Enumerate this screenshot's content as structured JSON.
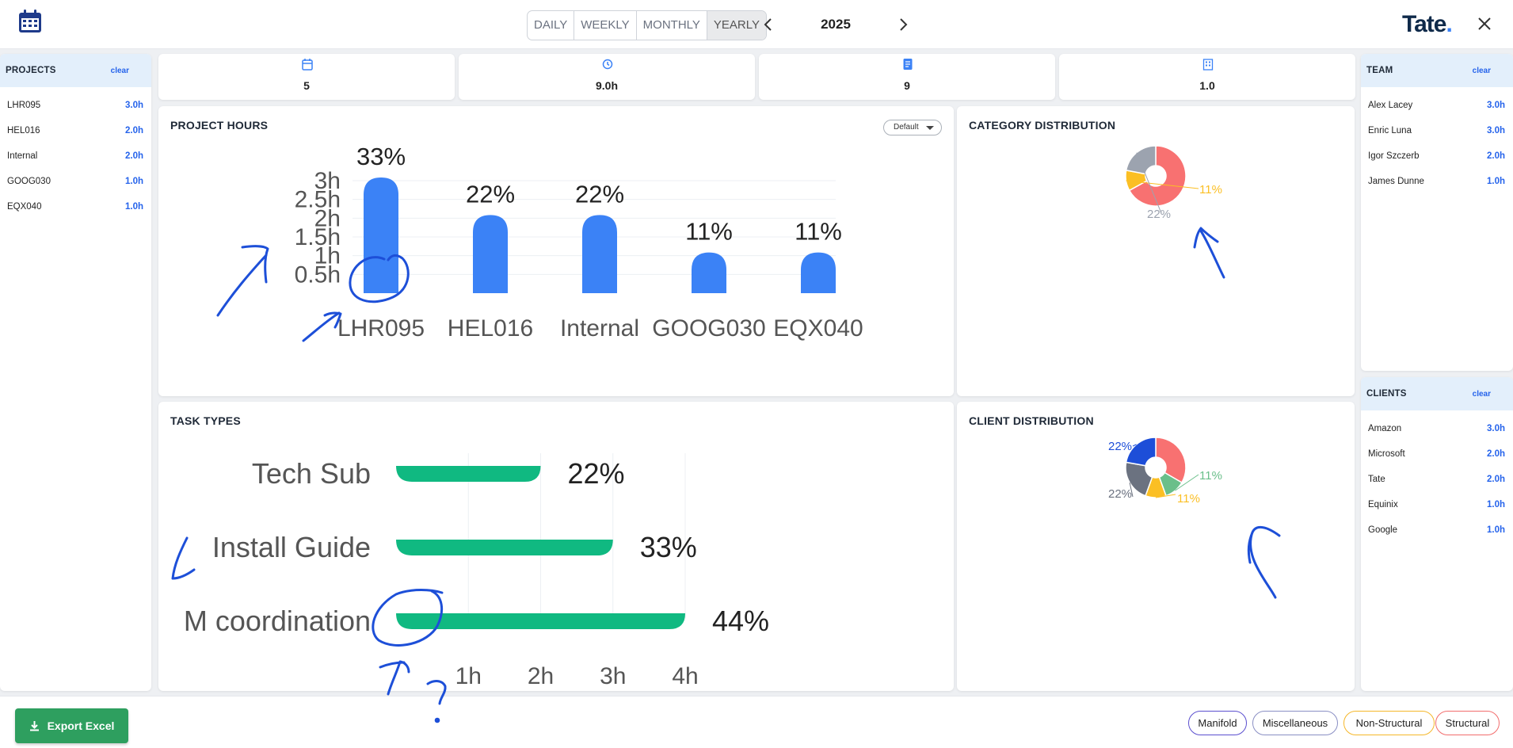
{
  "header": {
    "periods": [
      "DAILY",
      "WEEKLY",
      "MONTHLY",
      "YEARLY"
    ],
    "active_period": "YEARLY",
    "year": "2025",
    "brand": "Tate",
    "brand_dot": "."
  },
  "projects_panel": {
    "title": "PROJECTS",
    "clear_label": "clear",
    "items": [
      {
        "label": "LHR095",
        "hours": "3.0h"
      },
      {
        "label": "HEL016",
        "hours": "2.0h"
      },
      {
        "label": "Internal",
        "hours": "2.0h"
      },
      {
        "label": "GOOG030",
        "hours": "1.0h"
      },
      {
        "label": "EQX040",
        "hours": "1.0h"
      }
    ]
  },
  "stats": [
    {
      "icon": "calendar-icon",
      "value": "5"
    },
    {
      "icon": "clock-icon",
      "value": "9.0h"
    },
    {
      "icon": "document-icon",
      "value": "9"
    },
    {
      "icon": "building-icon",
      "value": "1.0"
    }
  ],
  "project_hours": {
    "title": "PROJECT HOURS",
    "dropdown_value": "Default"
  },
  "category_distribution": {
    "title": "CATEGORY DISTRIBUTION"
  },
  "task_types": {
    "title": "TASK TYPES"
  },
  "client_distribution": {
    "title": "CLIENT DISTRIBUTION"
  },
  "team_panel": {
    "title": "TEAM",
    "clear_label": "clear",
    "items": [
      {
        "label": "Alex Lacey",
        "hours": "3.0h"
      },
      {
        "label": "Enric Luna",
        "hours": "3.0h"
      },
      {
        "label": "Igor Szczerb",
        "hours": "2.0h"
      },
      {
        "label": "James Dunne",
        "hours": "1.0h"
      }
    ]
  },
  "clients_panel": {
    "title": "CLIENTS",
    "clear_label": "clear",
    "items": [
      {
        "label": "Amazon",
        "hours": "3.0h"
      },
      {
        "label": "Microsoft",
        "hours": "2.0h"
      },
      {
        "label": "Tate",
        "hours": "2.0h"
      },
      {
        "label": "Equinix",
        "hours": "1.0h"
      },
      {
        "label": "Google",
        "hours": "1.0h"
      }
    ]
  },
  "footer": {
    "export_label": "Export Excel",
    "legend": [
      {
        "label": "Manifold",
        "color": "#5b4fcf"
      },
      {
        "label": "Miscellaneous",
        "color": "#8a8fc4"
      },
      {
        "label": "Non-Structural",
        "color": "#f5b72a"
      },
      {
        "label": "Structural",
        "color": "#f26d6d"
      }
    ]
  },
  "colors": {
    "accent": "#2563eb",
    "bar_blue": "#3b82f6",
    "bar_green": "#10b981",
    "export_green": "#2e9f5f"
  },
  "chart_data": [
    {
      "type": "bar",
      "title": "PROJECT HOURS",
      "categories": [
        "LHR095",
        "HEL016",
        "Internal",
        "GOOG030",
        "EQX040"
      ],
      "values": [
        3,
        2,
        2,
        1,
        1
      ],
      "data_labels": [
        "33%",
        "22%",
        "22%",
        "11%",
        "11%"
      ],
      "y_ticks": [
        "0.5h",
        "1h",
        "1.5h",
        "2h",
        "2.5h",
        "3h"
      ],
      "ylim": [
        0,
        3
      ]
    },
    {
      "type": "pie",
      "title": "CATEGORY DISTRIBUTION",
      "values": [
        67,
        11,
        22
      ],
      "colors": [
        "#f87171",
        "#fbbf24",
        "#9ca3af"
      ],
      "labels": [
        "",
        "11%",
        "22%"
      ]
    },
    {
      "type": "bar",
      "orientation": "horizontal",
      "title": "TASK TYPES",
      "categories": [
        "Tech Sub",
        "Install Guide",
        "M coordination"
      ],
      "values": [
        2,
        3,
        4
      ],
      "data_labels": [
        "22%",
        "33%",
        "44%"
      ],
      "x_ticks": [
        "1h",
        "2h",
        "3h",
        "4h"
      ],
      "xlim": [
        0,
        4
      ]
    },
    {
      "type": "pie",
      "title": "CLIENT DISTRIBUTION",
      "values": [
        33,
        11,
        11,
        22,
        22
      ],
      "colors": [
        "#f87171",
        "#6abf8a",
        "#fbbf24",
        "#6b7280",
        "#1d4ed8"
      ],
      "labels": [
        "",
        "11%",
        "11%",
        "22%",
        "22%"
      ]
    }
  ]
}
